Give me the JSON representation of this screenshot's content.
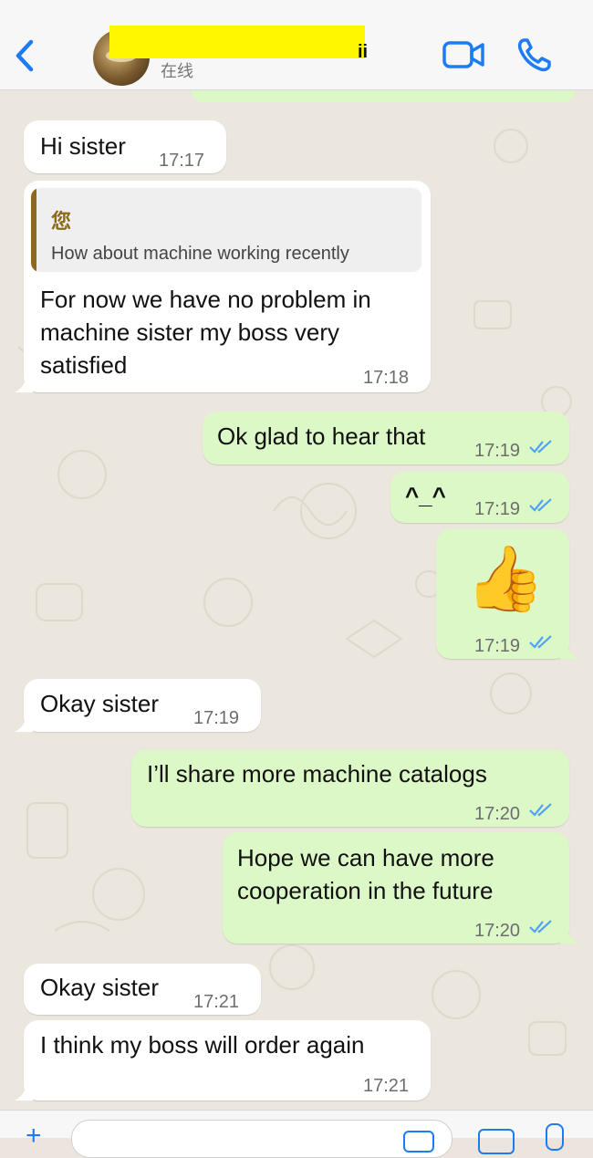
{
  "header": {
    "name_tail": "ii",
    "presence": "在线",
    "accent_color": "#1d7cf2",
    "back_icon": "chevron-left-icon",
    "video_icon": "video-camera-icon",
    "call_icon": "phone-icon"
  },
  "messages": [
    {
      "id": "m1",
      "direction": "incoming",
      "text": "Hi sister",
      "time": "17:17"
    },
    {
      "id": "m2",
      "direction": "incoming",
      "reply_to": {
        "author": "您",
        "text": "How about machine working recently"
      },
      "lines": [
        "For now we have no problem in",
        "machine sister my boss very",
        "satisfied"
      ],
      "time": "17:18"
    },
    {
      "id": "m3",
      "direction": "outgoing",
      "text": "Ok glad to hear that",
      "time": "17:19",
      "read": true
    },
    {
      "id": "m4",
      "direction": "outgoing",
      "text": "^_^",
      "time": "17:19",
      "read": true
    },
    {
      "id": "m5",
      "direction": "outgoing",
      "emoji": "👍",
      "time": "17:19",
      "read": true
    },
    {
      "id": "m6",
      "direction": "incoming",
      "text": "Okay sister",
      "time": "17:19"
    },
    {
      "id": "m7",
      "direction": "outgoing",
      "text": "I’ll share more machine catalogs",
      "time": "17:20",
      "read": true
    },
    {
      "id": "m8",
      "direction": "outgoing",
      "lines": [
        "Hope we can have more",
        "cooperation in the future"
      ],
      "time": "17:20",
      "read": true
    },
    {
      "id": "m9",
      "direction": "incoming",
      "text": "Okay sister",
      "time": "17:21"
    },
    {
      "id": "m10",
      "direction": "incoming",
      "text": "I think my boss will order again",
      "time": "17:21"
    }
  ],
  "input_bar": {
    "plus_icon": "plus-icon",
    "sticker_icon": "sticker-icon",
    "camera_icon": "camera-icon",
    "mic_icon": "microphone-icon"
  },
  "colors": {
    "incoming_bubble": "#ffffff",
    "outgoing_bubble": "#dcf8c6",
    "read_tick": "#4fa3f7",
    "chat_background": "#ebe6de",
    "quote_accent": "#8d6a1b"
  }
}
